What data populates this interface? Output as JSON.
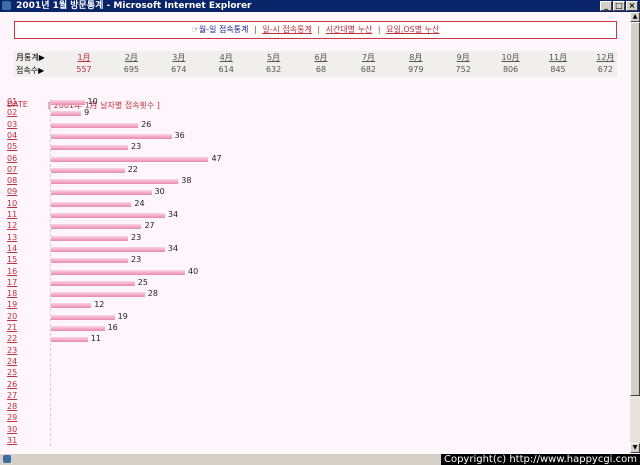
{
  "window": {
    "title": "2001년 1월 방문통계 - Microsoft Internet Explorer",
    "buttons": [
      "_",
      "□",
      "×"
    ]
  },
  "nav": {
    "items": [
      {
        "label": "☞월-일 접속통계",
        "current": true
      },
      {
        "label": "일-시 접속통계",
        "current": false
      },
      {
        "label": "시간대별 누산",
        "current": false
      },
      {
        "label": "요일,OS별 누산",
        "current": false
      }
    ],
    "separator": "|"
  },
  "summary": {
    "month_label": "月통계▶",
    "count_label": "접속수▶",
    "months": [
      "1月",
      "2月",
      "3月",
      "4月",
      "5月",
      "6月",
      "7月",
      "8月",
      "9月",
      "10月",
      "11月",
      "12月"
    ],
    "counts": [
      "557",
      "695",
      "674",
      "614",
      "632",
      "68",
      "682",
      "979",
      "752",
      "806",
      "845",
      "672"
    ],
    "current_index": 0
  },
  "chart_header": {
    "date_label": "DATE",
    "title": "[ 2001年 1月 날자별 접속횟수 ]"
  },
  "chart_data": {
    "type": "bar",
    "orientation": "horizontal",
    "title": "[ 2001年 1月 날자별 접속횟수 ]",
    "categories": [
      "01",
      "02",
      "03",
      "04",
      "05",
      "06",
      "07",
      "08",
      "09",
      "10",
      "11",
      "12",
      "13",
      "14",
      "15",
      "16",
      "17",
      "18",
      "19",
      "20",
      "21",
      "22",
      "23",
      "24",
      "25",
      "26",
      "27",
      "28",
      "29",
      "30",
      "31"
    ],
    "values": [
      10,
      9,
      26,
      36,
      23,
      47,
      22,
      38,
      30,
      24,
      34,
      27,
      23,
      34,
      23,
      40,
      25,
      28,
      12,
      19,
      16,
      11,
      null,
      null,
      null,
      null,
      null,
      null,
      null,
      null,
      null
    ],
    "bar_color": "#f0a0bc"
  },
  "status": {
    "copyright": "Copyright(c) http://www.happycgi.com"
  }
}
